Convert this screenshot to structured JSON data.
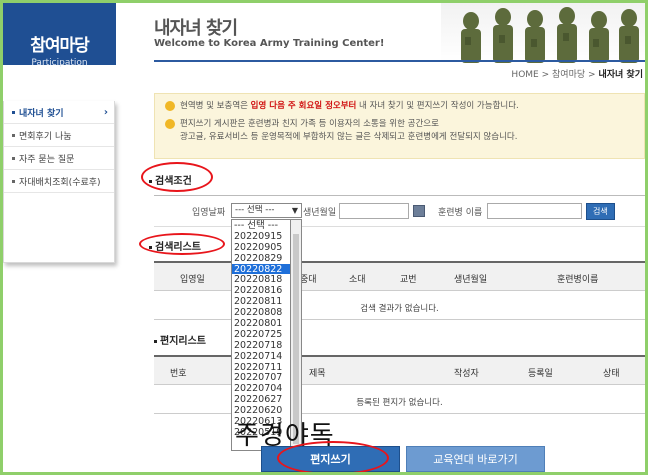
{
  "sidebar": {
    "title": "참여마당",
    "subtitle": "Participation",
    "items": [
      {
        "label": "내자녀 찾기",
        "active": true
      },
      {
        "label": "면회후기 나눔",
        "active": false
      },
      {
        "label": "자주 묻는 질문",
        "active": false
      },
      {
        "label": "자대배치조회(수료후)",
        "active": false
      }
    ]
  },
  "header": {
    "title": "내자녀 찾기",
    "subtitle": "Welcome to Korea Army Training Center!"
  },
  "breadcrumb": {
    "home": "HOME",
    "sep1": ">",
    "section": "참여마당",
    "sep2": ">",
    "current": "내자녀 찾기"
  },
  "notice": {
    "line1_pre": "현역병 및 보충역은 ",
    "line1_red": "입영 다음 주 회요일 정오부터",
    "line1_post": " 내 자녀 찾기 및 편지쓰기 작성이 가능합니다.",
    "line2": "편지쓰기 게시판은 훈련병과 친지 가족 등 이용자의 소통을 위한 공간으로",
    "line3": "광고글, 유료서비스 등 운영목적에 부합하지 않는 글은 삭제되고 훈련병에게 전달되지 않습니다."
  },
  "search": {
    "section_title": "검색조건",
    "enlist_label": "입영날짜",
    "select_value": "--- 선택 ---",
    "birth_label": "생년월일",
    "name_label": "훈련병 이름",
    "search_button": "검색"
  },
  "dropdown": {
    "options": [
      "--- 선택 ---",
      "20220915",
      "20220905",
      "20220829",
      "20220822",
      "20220818",
      "20220816",
      "20220811",
      "20220808",
      "20220801",
      "20220725",
      "20220718",
      "20220714",
      "20220711",
      "20220707",
      "20220704",
      "20220627",
      "20220620",
      "20220613",
      "20220519"
    ],
    "selected_index": 4
  },
  "result": {
    "section_title": "검색리스트",
    "columns": [
      "입영일",
      "중대",
      "소대",
      "교번",
      "생년월일",
      "훈련병이름"
    ],
    "empty_text": "검색 결과가 없습니다."
  },
  "letters": {
    "section_title": "편지리스트",
    "columns": [
      "번호",
      "제목",
      "작성자",
      "등록일",
      "상태"
    ],
    "empty_text": "등록된 편지가 없습니다."
  },
  "buttons": {
    "write": "편지쓰기",
    "go": "교육연대 바로가기"
  },
  "overlay": {
    "text": "주경야독"
  },
  "colors": {
    "brand": "#1f4f93",
    "accent_red": "#e8151b",
    "notice_bg": "#fbf5dc",
    "border_green": "#8fcf6a"
  }
}
